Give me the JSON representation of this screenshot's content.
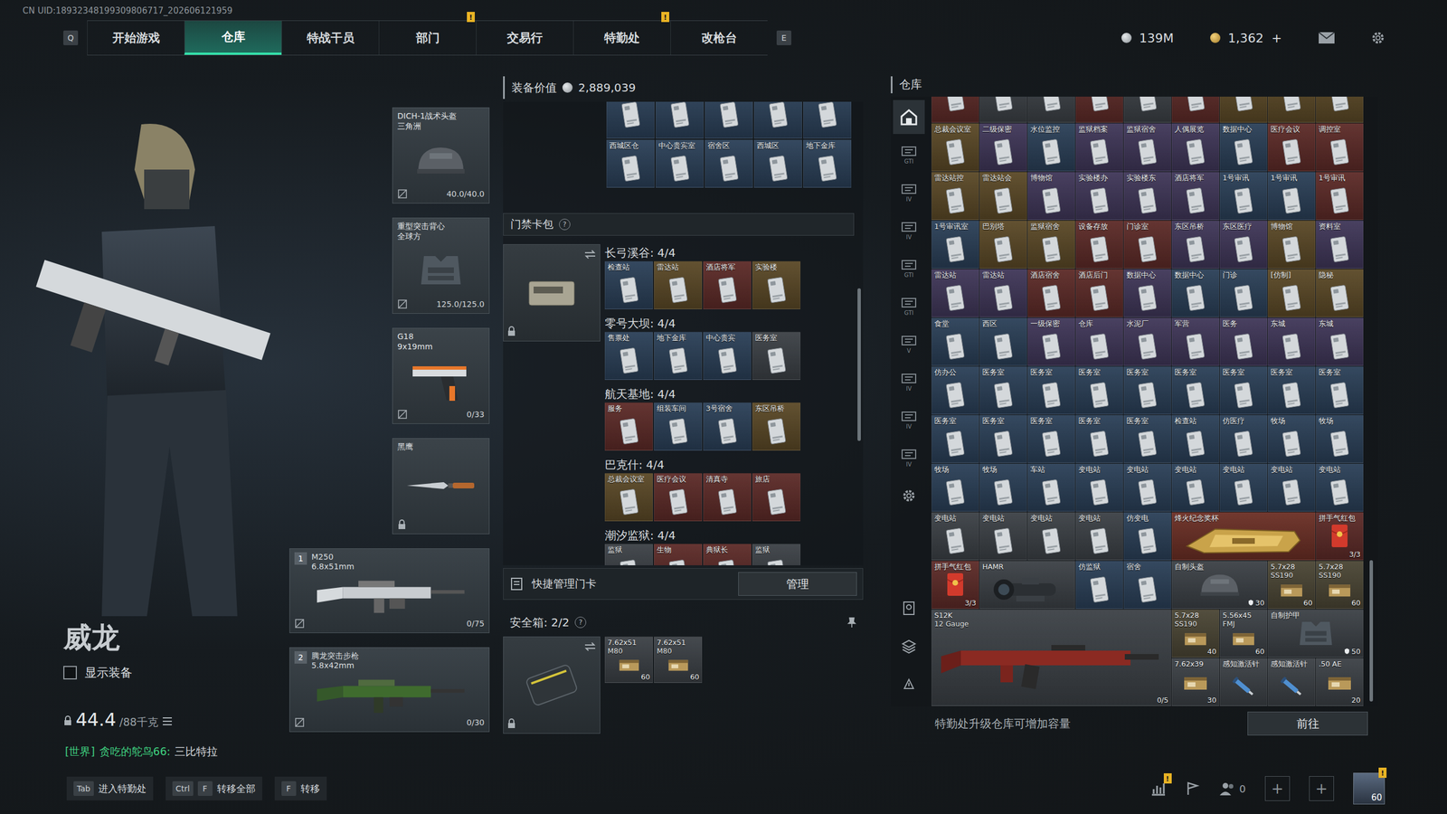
{
  "uid": "CN UID:18932348199309806717_202606121959",
  "nav": {
    "left_key": "Q",
    "right_key": "E",
    "tabs": [
      {
        "label": "开始游戏",
        "selected": false
      },
      {
        "label": "仓库",
        "selected": true
      },
      {
        "label": "特战干员",
        "selected": false
      },
      {
        "label": "部门",
        "selected": false,
        "badge": "!"
      },
      {
        "label": "交易行",
        "selected": false
      },
      {
        "label": "特勤处",
        "selected": false,
        "badge": "!"
      },
      {
        "label": "改枪台",
        "selected": false
      }
    ]
  },
  "currency": {
    "coins": "139M",
    "tickets": "1,362",
    "add": "+"
  },
  "player": {
    "name": "威龙",
    "show_gear": {
      "label": "显示装备",
      "checked": false
    },
    "weight": "44.4",
    "weight_max": "/88千克",
    "chat": {
      "channel": "[世界]",
      "sender": "贪吃的鸵鸟66:",
      "message": "三比特拉"
    }
  },
  "equipment": [
    {
      "kind": "helmet",
      "name": "DICH-1战术头盔",
      "sub": "三角洲",
      "reading": "40.0/40.0"
    },
    {
      "kind": "armor",
      "name": "重型突击背心",
      "sub": "全球方",
      "reading": "125.0/125.0"
    },
    {
      "kind": "pistol",
      "name": "G18",
      "sub": "9x19mm",
      "reading": "0/33"
    },
    {
      "kind": "knife",
      "name": "黑鹰"
    }
  ],
  "weapons": [
    {
      "kind": "m250",
      "index": "1",
      "name": "M250",
      "caliber": "6.8x51mm",
      "ammo": "0/75"
    },
    {
      "kind": "rifle",
      "index": "2",
      "name": "腾龙突击步枪",
      "caliber": "5.8x42mm",
      "ammo": "0/30"
    }
  ],
  "loadout": {
    "title": "装备价值",
    "value": "2,889,039",
    "top_cards": [
      {
        "kind": "card",
        "color": "#2a3f57"
      },
      {
        "kind": "card",
        "color": "#2a3f57"
      },
      {
        "kind": "card",
        "color": "#2a3f57"
      },
      {
        "kind": "card",
        "color": "#2a3f57"
      },
      {
        "kind": "card",
        "color": "#2a3f57"
      },
      {
        "kind": "card",
        "label": "西城区仓",
        "color": "#2a3f57"
      },
      {
        "kind": "card",
        "label": "中心贵宾室",
        "color": "#2a3f57"
      },
      {
        "kind": "card",
        "label": "宿舍区",
        "color": "#2a3f57"
      },
      {
        "kind": "card",
        "label": "西城区",
        "color": "#2a3f57"
      },
      {
        "kind": "card",
        "label": "地下金库",
        "color": "#2a3f57"
      }
    ],
    "card_pack": {
      "title": "门禁卡包",
      "help": "?",
      "groups": [
        {
          "map": "长弓溪谷: 4/4",
          "cards": [
            {
              "kind": "card",
              "label": "检查站",
              "color": "#2a3f57"
            },
            {
              "kind": "card",
              "label": "雷达站",
              "color": "#5a4826"
            },
            {
              "kind": "card",
              "label": "酒店将军",
              "color": "#5c2a27"
            },
            {
              "kind": "card",
              "label": "实验楼",
              "color": "#5a4826"
            }
          ]
        },
        {
          "map": "零号大坝: 4/4",
          "cards": [
            {
              "kind": "card",
              "label": "售票处",
              "color": "#2a3f57"
            },
            {
              "kind": "card",
              "label": "地下金库",
              "color": "#2a3f57"
            },
            {
              "kind": "card",
              "label": "中心贵宾",
              "color": "#2a3f57"
            },
            {
              "kind": "card",
              "label": "医务室",
              "color": "#3b4045"
            }
          ]
        },
        {
          "map": "航天基地: 4/4",
          "cards": [
            {
              "kind": "card",
              "label": "服务",
              "color": "#5c2a27"
            },
            {
              "kind": "card",
              "label": "组装车间",
              "color": "#2a3f57"
            },
            {
              "kind": "card",
              "label": "3号宿舍",
              "color": "#2a3f57"
            },
            {
              "kind": "card",
              "label": "东区吊桥",
              "color": "#5a4826"
            }
          ]
        },
        {
          "map": "巴克什: 4/4",
          "cards": [
            {
              "kind": "card",
              "label": "总裁会议室",
              "color": "#5a4826"
            },
            {
              "kind": "card",
              "label": "医疗会议",
              "color": "#5c2a27"
            },
            {
              "kind": "card",
              "label": "清真寺",
              "color": "#5c2a27"
            },
            {
              "kind": "card",
              "label": "旅店",
              "color": "#5c2a27"
            }
          ]
        },
        {
          "map": "潮汐监狱: 4/4",
          "cards": [
            {
              "kind": "card",
              "label": "监狱",
              "color": "#3b4045"
            },
            {
              "kind": "card",
              "label": "生物",
              "color": "#5c2a27"
            },
            {
              "kind": "card",
              "label": "典狱长",
              "color": "#5c2a27"
            },
            {
              "kind": "card",
              "label": "监狱",
              "color": "#3b4045"
            }
          ]
        }
      ]
    },
    "quick": {
      "label": "快捷管理门卡",
      "button": "管理"
    },
    "safe": {
      "title": "安全箱: 2/2",
      "help": "?",
      "items": [
        {
          "kind": "ammo",
          "label": "7.62x51",
          "sub": "M80",
          "count": "60",
          "color": "#3b4045"
        },
        {
          "kind": "ammo",
          "label": "7.62x51",
          "sub": "M80",
          "count": "60",
          "color": "#3b4045"
        }
      ]
    }
  },
  "warehouse": {
    "title": "仓库",
    "side_tabs": [
      {
        "kind": "home",
        "selected": true
      },
      {
        "kind": "tab",
        "label": "GTI",
        "selected": false
      },
      {
        "kind": "tab",
        "label": "IV",
        "selected": false
      },
      {
        "kind": "tab",
        "label": "IV",
        "selected": false
      },
      {
        "kind": "tab",
        "label": "GTI",
        "selected": false
      },
      {
        "kind": "tab",
        "label": "GTI",
        "selected": false
      },
      {
        "kind": "tab",
        "label": "V",
        "selected": false
      },
      {
        "kind": "tab",
        "label": "IV",
        "selected": false
      },
      {
        "kind": "tab",
        "label": "IV",
        "selected": false
      },
      {
        "kind": "tab",
        "label": "IV",
        "selected": false
      },
      {
        "kind": "settings",
        "selected": false
      }
    ],
    "items": [
      {
        "kind": "card",
        "color": "#5c2a27"
      },
      {
        "kind": "card",
        "color": "#3b4045"
      },
      {
        "kind": "card",
        "color": "#3b4045"
      },
      {
        "kind": "card",
        "color": "#5c2a27"
      },
      {
        "kind": "card",
        "color": "#3b4045"
      },
      {
        "kind": "card",
        "color": "#5c2a27"
      },
      {
        "kind": "card",
        "color": "#5a4826"
      },
      {
        "kind": "card",
        "color": "#5a4826"
      },
      {
        "kind": "card",
        "color": "#5a4826"
      },
      {
        "kind": "card",
        "label": "总裁会议室",
        "color": "#5a4826"
      },
      {
        "kind": "card",
        "label": "二级保密",
        "color": "#3f3658"
      },
      {
        "kind": "card",
        "label": "水位监控",
        "color": "#2a3f57"
      },
      {
        "kind": "card",
        "label": "监狱档案",
        "color": "#3f3658"
      },
      {
        "kind": "card",
        "label": "监狱宿舍",
        "color": "#3f3658"
      },
      {
        "kind": "card",
        "label": "人偶展览",
        "color": "#3f3658"
      },
      {
        "kind": "card",
        "label": "数据中心",
        "color": "#2a3f57"
      },
      {
        "kind": "card",
        "label": "医疗会议",
        "color": "#5c2a27"
      },
      {
        "kind": "card",
        "label": "调控室",
        "color": "#5c2a27"
      },
      {
        "kind": "card",
        "label": "雷达站控",
        "color": "#5a4826"
      },
      {
        "kind": "card",
        "label": "雷达站会",
        "color": "#5a4826"
      },
      {
        "kind": "card",
        "label": "博物馆",
        "color": "#3f3658"
      },
      {
        "kind": "card",
        "label": "实验楼办",
        "color": "#3f3658"
      },
      {
        "kind": "card",
        "label": "实验楼东",
        "color": "#3f3658"
      },
      {
        "kind": "card",
        "label": "酒店将军",
        "color": "#3f3658"
      },
      {
        "kind": "card",
        "label": "1号审讯",
        "color": "#2a3f57"
      },
      {
        "kind": "card",
        "label": "1号审讯",
        "color": "#2a3f57"
      },
      {
        "kind": "card",
        "label": "1号审讯",
        "color": "#5c2a27"
      },
      {
        "kind": "card",
        "label": "1号审讯室",
        "color": "#2a3f57"
      },
      {
        "kind": "card",
        "label": "巴别塔",
        "color": "#5a4826"
      },
      {
        "kind": "card",
        "label": "监狱宿舍",
        "color": "#5a4826"
      },
      {
        "kind": "card",
        "label": "设备存放",
        "color": "#5c2a27"
      },
      {
        "kind": "card",
        "label": "门诊室",
        "color": "#5c2a27"
      },
      {
        "kind": "card",
        "label": "东区吊桥",
        "color": "#3f3658"
      },
      {
        "kind": "card",
        "label": "东区医疗",
        "color": "#3f3658"
      },
      {
        "kind": "card",
        "label": "博物馆",
        "color": "#5a4826"
      },
      {
        "kind": "card",
        "label": "资料室",
        "color": "#3f3658"
      },
      {
        "kind": "card",
        "label": "雷达站",
        "color": "#3f3658"
      },
      {
        "kind": "card",
        "label": "雷达站",
        "color": "#3f3658"
      },
      {
        "kind": "card",
        "label": "酒店宿舍",
        "color": "#5c2a27"
      },
      {
        "kind": "card",
        "label": "酒店后门",
        "color": "#5c2a27"
      },
      {
        "kind": "card",
        "label": "数据中心",
        "color": "#3f3658"
      },
      {
        "kind": "card",
        "label": "数据中心",
        "color": "#2a3f57"
      },
      {
        "kind": "card",
        "label": "门诊",
        "color": "#2a3f57"
      },
      {
        "kind": "card",
        "label": "[仿制]",
        "color": "#5a4826"
      },
      {
        "kind": "card",
        "label": "隐秘",
        "color": "#5a4826"
      },
      {
        "kind": "card",
        "label": "食堂",
        "color": "#2a3f57"
      },
      {
        "kind": "card",
        "label": "西区",
        "color": "#2a3f57"
      },
      {
        "kind": "card",
        "label": "一级保密",
        "color": "#3f3658"
      },
      {
        "kind": "card",
        "label": "仓库",
        "color": "#3f3658"
      },
      {
        "kind": "card",
        "label": "水泥厂",
        "color": "#3f3658"
      },
      {
        "kind": "card",
        "label": "军营",
        "color": "#3f3658"
      },
      {
        "kind": "card",
        "label": "医务",
        "color": "#3f3658"
      },
      {
        "kind": "card",
        "label": "东城",
        "color": "#3f3658"
      },
      {
        "kind": "card",
        "label": "东城",
        "color": "#3f3658"
      },
      {
        "kind": "card",
        "label": "仿办公",
        "color": "#2a3f57"
      },
      {
        "kind": "card",
        "label": "医务室",
        "color": "#2a3f57"
      },
      {
        "kind": "card",
        "label": "医务室",
        "color": "#2a3f57"
      },
      {
        "kind": "card",
        "label": "医务室",
        "color": "#2a3f57"
      },
      {
        "kind": "card",
        "label": "医务室",
        "color": "#2a3f57"
      },
      {
        "kind": "card",
        "label": "医务室",
        "color": "#2a3f57"
      },
      {
        "kind": "card",
        "label": "医务室",
        "color": "#2a3f57"
      },
      {
        "kind": "card",
        "label": "医务室",
        "color": "#2a3f57"
      },
      {
        "kind": "card",
        "label": "医务室",
        "color": "#2a3f57"
      },
      {
        "kind": "card",
        "label": "医务室",
        "color": "#2a3f57"
      },
      {
        "kind": "card",
        "label": "医务室",
        "color": "#2a3f57"
      },
      {
        "kind": "card",
        "label": "医务室",
        "color": "#2a3f57"
      },
      {
        "kind": "card",
        "label": "医务室",
        "color": "#2a3f57"
      },
      {
        "kind": "card",
        "label": "医务室",
        "color": "#2a3f57"
      },
      {
        "kind": "card",
        "label": "检查站",
        "color": "#2a3f57"
      },
      {
        "kind": "card",
        "label": "仿医疗",
        "color": "#2a3f57"
      },
      {
        "kind": "card",
        "label": "牧场",
        "color": "#2a3f57"
      },
      {
        "kind": "card",
        "label": "牧场",
        "color": "#2a3f57"
      },
      {
        "kind": "card",
        "label": "牧场",
        "color": "#2a3f57"
      },
      {
        "kind": "card",
        "label": "牧场",
        "color": "#2a3f57"
      },
      {
        "kind": "card",
        "label": "车站",
        "color": "#2a3f57"
      },
      {
        "kind": "card",
        "label": "变电站",
        "color": "#2a3f57"
      },
      {
        "kind": "card",
        "label": "变电站",
        "color": "#2a3f57"
      },
      {
        "kind": "card",
        "label": "变电站",
        "color": "#2a3f57"
      },
      {
        "kind": "card",
        "label": "变电站",
        "color": "#2a3f57"
      },
      {
        "kind": "card",
        "label": "变电站",
        "color": "#2a3f57"
      },
      {
        "kind": "card",
        "label": "变电站",
        "color": "#2a3f57"
      },
      {
        "kind": "card",
        "label": "变电站",
        "color": "#3b4045"
      },
      {
        "kind": "card",
        "label": "变电站",
        "color": "#3b4045"
      },
      {
        "kind": "card",
        "label": "变电站",
        "color": "#3b4045"
      },
      {
        "kind": "card",
        "label": "变电站",
        "color": "#3b4045"
      },
      {
        "kind": "card",
        "label": "仿变电",
        "color": "#2a3f57"
      },
      {
        "kind": "trophy",
        "label": "烽火纪念奖杯",
        "color": "#6a2e24"
      },
      {
        "kind": "redpack",
        "label": "拼手气红包",
        "count": "3/3",
        "color": "#5c2a27"
      },
      {
        "kind": "redpack",
        "label": "拼手气红包",
        "count": "3/3",
        "color": "#5c2a27"
      },
      {
        "kind": "scope",
        "label": "HAMR",
        "color": "#3b4045"
      },
      {
        "kind": "card",
        "label": "仿监狱",
        "color": "#2a3f57"
      },
      {
        "kind": "card",
        "label": "宿舍",
        "color": "#2a3f57"
      },
      {
        "kind": "helmet",
        "label": "自制头盔",
        "count": "30",
        "color": "#3b4045"
      },
      {
        "kind": "ammo",
        "label": "5.7x28",
        "sub": "SS190",
        "count": "60",
        "color": "#4a4534"
      },
      {
        "kind": "ammo",
        "label": "5.7x28",
        "sub": "SS190",
        "count": "60",
        "color": "#4a4534"
      },
      {
        "kind": "shotgun",
        "label": "S12K",
        "sub": "12 Gauge",
        "count": "0/5",
        "color": "#3b4045"
      },
      {
        "kind": "ammo",
        "label": "5.7x28",
        "sub": "SS190",
        "count": "40",
        "color": "#4a4534"
      },
      {
        "kind": "ammo",
        "label": "5.56x45",
        "sub": "FMJ",
        "count": "60",
        "color": "#3b4045"
      },
      {
        "kind": "armor",
        "label": "自制护甲",
        "count": "50",
        "color": "#3b4045"
      },
      {
        "kind": "ammo",
        "label": "7.62x39",
        "count": "30",
        "color": "#3b4045"
      },
      {
        "kind": "injector",
        "label": "感知激活针",
        "color": "#3b4045"
      },
      {
        "kind": "injector",
        "label": "感知激活针",
        "color": "#3b4045"
      },
      {
        "kind": "ammo",
        "label": ".50 AE",
        "count": "20",
        "color": "#3b4045"
      }
    ],
    "hint": "特勤处升级仓库可增加容量",
    "button": "前往"
  },
  "bottom": {
    "keys": [
      {
        "keys": [
          "Tab"
        ],
        "label": "进入特勤处"
      },
      {
        "keys": [
          "Ctrl",
          "F"
        ],
        "label": "转移全部"
      },
      {
        "keys": [
          "F"
        ],
        "label": "转移"
      }
    ],
    "stats_badge": "!",
    "friends": "0",
    "slots": [
      "+",
      "+"
    ],
    "level": "60",
    "avatar_badge": "!"
  }
}
